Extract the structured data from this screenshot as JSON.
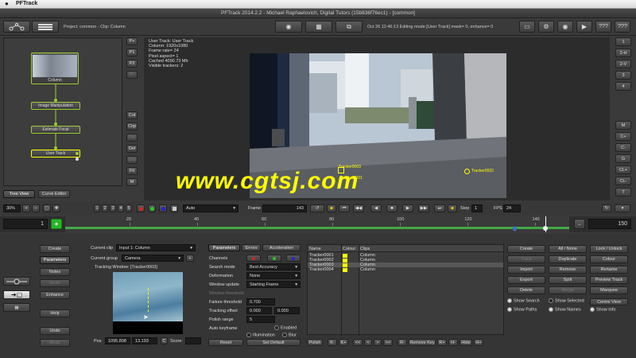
{
  "menubar": {
    "app_name": "PFTrack"
  },
  "window": {
    "title": "PFTrack 2014.2.2 - Michael Raphaelovich, Digital Tutors (15b836f76ec1) - [common]"
  },
  "header": {
    "project": "Project: common - Clip: Column",
    "status": "Oct 26 12:46:13 Editing mode [User Track] mask= 0, enhance= 0"
  },
  "right_toolbar": {
    "help1": "???",
    "help2": "???"
  },
  "node_tree": {
    "nodes": [
      "Column",
      "Image Manipulation",
      "Estimate Focal",
      "User Track"
    ],
    "side_buttons": [
      "P+",
      "P1",
      "P2",
      "P-",
      "Cut",
      "Cop",
      "Pst",
      "Del",
      "Grp",
      "Fit",
      "M"
    ],
    "tabs": {
      "tree_view": "Tree View",
      "curve_editor": "Curve Editor"
    }
  },
  "viewport": {
    "info": [
      "User Track: User Track",
      "Column: 1920x1080",
      "Frame rate= 24",
      "Pixel aspect= 1",
      "Cached 4090.73 Mb",
      "Visible trackers: 2"
    ],
    "trackers": [
      "Tracker0003",
      "Tracker0001",
      "Tracker0002"
    ],
    "watermark": "www.cgtsj.com",
    "view_buttons": [
      "1",
      "2-H",
      "2-V",
      "3",
      "4",
      "M",
      "C+",
      "C-",
      "G",
      "CL+",
      "CL-",
      "T"
    ]
  },
  "playbar": {
    "zoom": "30%",
    "layouts": [
      "1",
      "2",
      "3",
      "4",
      "5"
    ],
    "display_mode": "Auto",
    "frame_label": "Frame",
    "frame_value": "143",
    "step_label": "Step",
    "step_value": "1",
    "fps_label": "FPS",
    "fps_value": "24"
  },
  "timeline": {
    "start": "1",
    "end": "150",
    "current_frame": 143,
    "first_frame": 1,
    "last_frame": 150,
    "ticks": [
      "20",
      "40",
      "60",
      "80",
      "100",
      "120",
      "140"
    ]
  },
  "left_menu": [
    "Create",
    "Parameters",
    "Notes",
    "Undo",
    "Enhance",
    "Help",
    "Undo",
    "Redo"
  ],
  "params": {
    "current_clip_label": "Current clip",
    "current_clip": "Input 1: Column",
    "current_group_label": "Current group",
    "current_group": "Camera",
    "tracking_window": "Tracking Window: [Tracker0003]",
    "pos_label": "Pos",
    "pos_x": "1095.808",
    "pos_y": "13.193",
    "score_btn": "C",
    "score_label": "Score:",
    "score_value": "",
    "tabs": [
      "Parameters",
      "Errors",
      "Acceleration"
    ],
    "channels_label": "Channels",
    "search_mode_label": "Search mode",
    "search_mode": "Best Accuracy",
    "deformation_label": "Deformation",
    "deformation": "None",
    "window_update_label": "Window update",
    "window_update": "Starting Frame",
    "window_threshold_label": "Window threshold",
    "failure_threshold_label": "Failure threshold",
    "failure_threshold": "0.700",
    "tracking_offset_label": "Tracking offset",
    "offset_x": "0.000",
    "offset_y": "0.000",
    "polish_range_label": "Polish range",
    "polish_range": "5",
    "auto_keyframe_label": "Auto keyframe",
    "enabled_label": "Enabled",
    "illumination_label": "Illumination",
    "blur_label": "Blur",
    "reset": "Reset",
    "set_default": "Set Default"
  },
  "tracker_table": {
    "headers": [
      "Name",
      "Colour",
      "Clips"
    ],
    "rows": [
      {
        "name": "Tracker0001",
        "clip": "Column",
        "selected": false
      },
      {
        "name": "Tracker0002",
        "clip": "Column",
        "selected": false
      },
      {
        "name": "Tracker0003",
        "clip": "Column",
        "selected": true
      },
      {
        "name": "Tracker0004",
        "clip": "Column",
        "selected": false
      }
    ],
    "bottom_buttons": [
      "Polish",
      "K-",
      "K+",
      "<<",
      "<",
      ">",
      ">>",
      "R-",
      "Remove Key",
      "R+",
      "H-",
      "Hide",
      "H+"
    ]
  },
  "actions": {
    "buttons": [
      [
        "Create",
        "All / None",
        "Lock / Unlock"
      ],
      [
        "Track",
        "Duplicate",
        "Colour"
      ],
      [
        "Import",
        "Remove",
        "Rename"
      ],
      [
        "Export",
        "Split",
        "Preview Track"
      ],
      [
        "Delete",
        "Merge",
        "Marquee"
      ]
    ],
    "checks": [
      {
        "label": "Show Search",
        "on": true
      },
      {
        "label": "Show Selected",
        "on": false
      },
      {
        "label": "Centre View",
        "on": false,
        "button": true
      },
      {
        "label": "Show Paths",
        "on": true
      },
      {
        "label": "Show Names",
        "on": true
      },
      {
        "label": "Show Info",
        "on": true
      }
    ]
  },
  "colors": {
    "accent_green": "#9acd32",
    "tracker_yellow": "#ffff00",
    "watermark": "#ffff00"
  }
}
